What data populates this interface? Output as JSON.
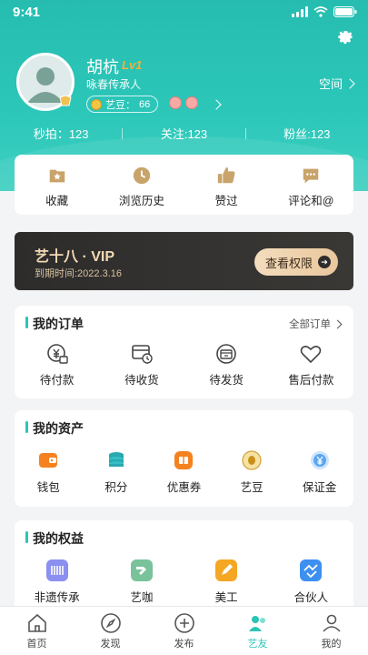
{
  "status": {
    "time": "9:41"
  },
  "profile": {
    "name": "胡杭",
    "level": "Lv1",
    "subtitle": "咏春传承人",
    "yidou_label": "艺豆：",
    "yidou_value": "66",
    "space_label": "空间"
  },
  "stats": [
    {
      "label": "秒拍",
      "value": "123"
    },
    {
      "label": "关注",
      "value": "123"
    },
    {
      "label": "粉丝",
      "value": "123"
    }
  ],
  "quick": [
    {
      "label": "收藏",
      "icon": "star-folder-icon"
    },
    {
      "label": "浏览历史",
      "icon": "clock-icon"
    },
    {
      "label": "赞过",
      "icon": "thumbs-up-icon"
    },
    {
      "label": "评论和@",
      "icon": "chat-icon"
    }
  ],
  "vip": {
    "title": "艺十八 · VIP",
    "expiry": "到期时间:2022.3.16",
    "button": "查看权限"
  },
  "orders": {
    "title": "我的订单",
    "more": "全部订单",
    "items": [
      {
        "label": "待付款",
        "icon": "wallet-yen-icon"
      },
      {
        "label": "待收货",
        "icon": "truck-clock-icon"
      },
      {
        "label": "待发货",
        "icon": "box-icon"
      },
      {
        "label": "售后付款",
        "icon": "heart-icon"
      }
    ]
  },
  "assets": {
    "title": "我的资产",
    "items": [
      {
        "label": "钱包",
        "icon": "wallet-icon",
        "color": "#f5821f"
      },
      {
        "label": "积分",
        "icon": "coins-stack-icon",
        "color": "#2aa8b0"
      },
      {
        "label": "优惠券",
        "icon": "coupon-icon",
        "color": "#f5821f"
      },
      {
        "label": "艺豆",
        "icon": "bean-coin-icon",
        "color": "#f0b323"
      },
      {
        "label": "保证金",
        "icon": "deposit-yen-icon",
        "color": "#5ba7f0"
      }
    ]
  },
  "rights": {
    "title": "我的权益",
    "items": [
      {
        "label": "非遗传承",
        "icon": "heritage-icon",
        "color": "#8b8ff0"
      },
      {
        "label": "艺咖",
        "icon": "brush-icon",
        "color": "#7ac29a"
      },
      {
        "label": "美工",
        "icon": "pen-icon",
        "color": "#f5a623"
      },
      {
        "label": "合伙人",
        "icon": "handshake-icon",
        "color": "#3d8ff0"
      }
    ]
  },
  "tabs": [
    {
      "label": "首页",
      "icon": "home-icon"
    },
    {
      "label": "发现",
      "icon": "compass-icon"
    },
    {
      "label": "发布",
      "icon": "plus-icon"
    },
    {
      "label": "艺友",
      "icon": "friends-icon"
    },
    {
      "label": "我的",
      "icon": "user-icon"
    }
  ],
  "colors": {
    "brand": "#2cc4b6",
    "vip_gold": "#f3d9b5"
  }
}
